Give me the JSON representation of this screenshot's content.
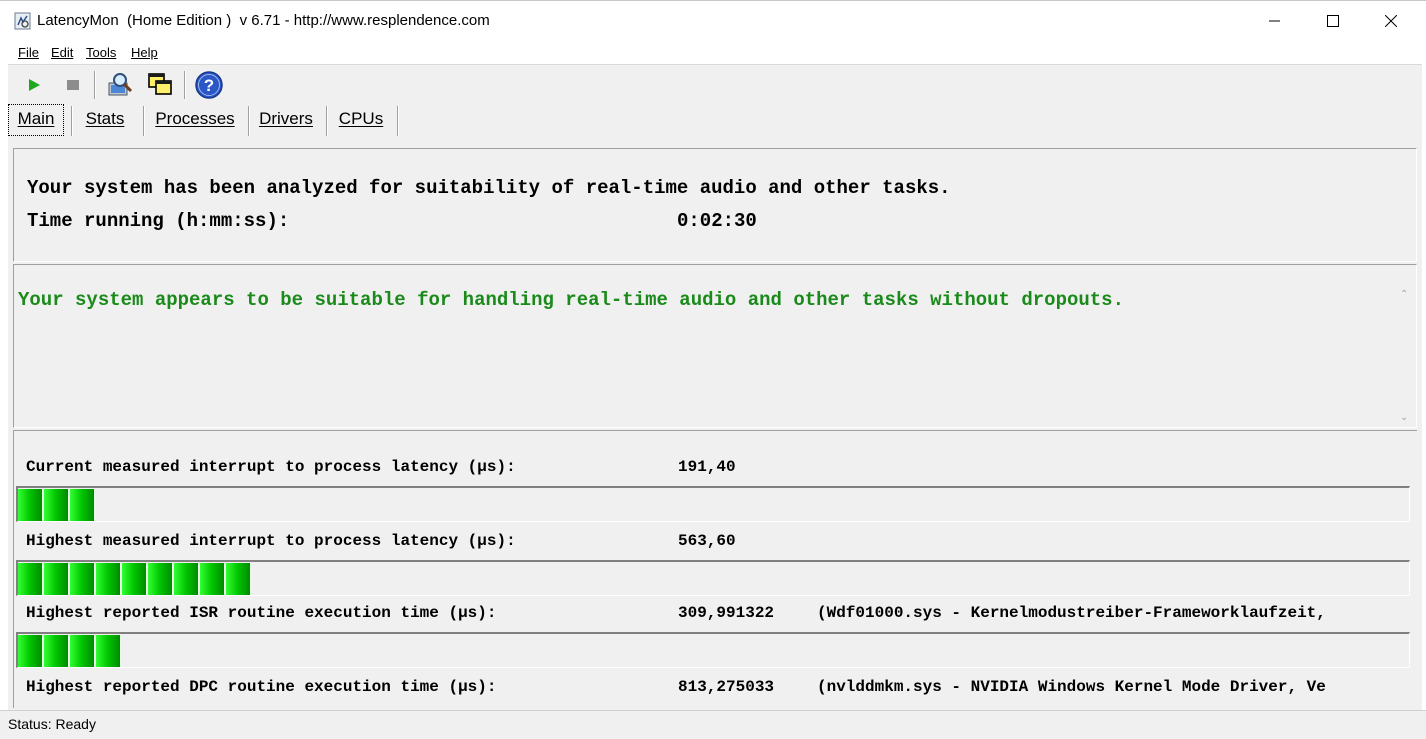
{
  "window": {
    "title": "LatencyMon  (Home Edition )  v 6.71 - http://www.resplendence.com",
    "controls": [
      "minimize",
      "maximize",
      "close"
    ]
  },
  "menu": {
    "items": [
      {
        "label": "File",
        "icon": ""
      },
      {
        "label": "Edit"
      },
      {
        "label": "Tools"
      },
      {
        "label": "Help"
      }
    ]
  },
  "toolbar": {
    "buttons": [
      {
        "name": "start",
        "icon": "play-icon",
        "color": "#1ea81e"
      },
      {
        "name": "stop",
        "icon": "stop-icon",
        "color": "#8c8c8c"
      },
      {
        "name": "analyze",
        "icon": "magnifier-computer-icon"
      },
      {
        "name": "windows",
        "icon": "cascade-windows-icon"
      },
      {
        "name": "help",
        "icon": "help-icon",
        "color": "#2a56c6"
      }
    ]
  },
  "tabs": [
    {
      "label": "Main",
      "active": true
    },
    {
      "label": "Stats",
      "active": false
    },
    {
      "label": "Processes",
      "active": false
    },
    {
      "label": "Drivers",
      "active": false
    },
    {
      "label": "CPUs",
      "active": false
    }
  ],
  "summary": {
    "line1": "Your system has been analyzed for suitability of real-time audio and other tasks.",
    "time_label": "Time running (h:mm:ss):",
    "time_value": "0:02:30"
  },
  "verdict": {
    "text": "Your system appears to be suitable for handling real-time audio and other tasks without dropouts.",
    "color": "#1a8a1a"
  },
  "measurements": [
    {
      "label": "Current measured interrupt to process latency (µs):",
      "value": "191,40",
      "extra": "",
      "meter_segments": 3
    },
    {
      "label": "Highest measured interrupt to process latency (µs):",
      "value": "563,60",
      "extra": "",
      "meter_segments": 9
    },
    {
      "label": "Highest reported ISR routine execution time (µs):",
      "value": "309,991322",
      "extra": "(Wdf01000.sys - Kernelmodustreiber-Frameworklaufzeit,",
      "meter_segments": 4
    },
    {
      "label": "Highest reported DPC routine execution time (µs):",
      "value": "813,275033",
      "extra": "(nvlddmkm.sys - NVIDIA Windows Kernel Mode Driver, Ve",
      "meter_segments": 0
    }
  ],
  "status": {
    "text": "Status: Ready"
  }
}
